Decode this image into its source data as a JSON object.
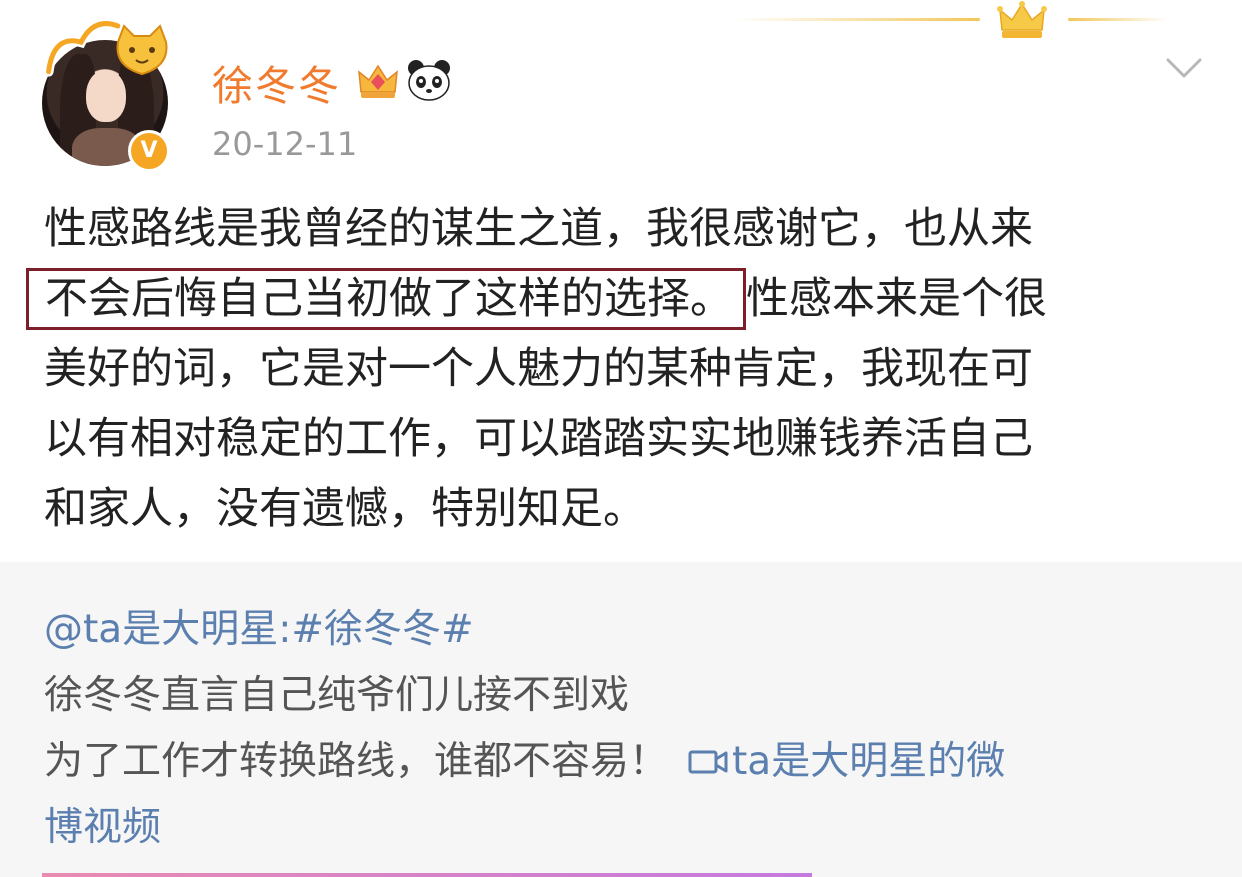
{
  "user": {
    "name": "徐冬冬",
    "date": "20-12-11",
    "avatar_sticker": "",
    "verified_badge": "V"
  },
  "post": {
    "line1": "性感路线是我曾经的谋生之道，我很感谢它，也从来",
    "line2_highlight": "不会后悔自己当初做了这样的选择。",
    "line2_rest": "性感本来是个很",
    "line3": "美好的词，它是对一个人魅力的某种肯定，我现在可",
    "line4": "以有相对稳定的工作，可以踏踏实实地赚钱养活自己",
    "line5": "和家人，没有遗憾，特别知足。"
  },
  "repost": {
    "user": "@ta是大明星",
    "separator": ":",
    "hashtag": "#徐冬冬#",
    "line1": "徐冬冬直言自己纯爷们儿接不到戏",
    "line2": "为了工作才转换路线，谁都不容易！",
    "video_link_part1": "ta是大明星的微",
    "video_link_part2": "博视频"
  },
  "icons": {
    "crown": "crown-icon",
    "vip": "vip-crown-icon",
    "panda": "panda-icon",
    "more": "chevron-down-icon",
    "video": "video-camera-icon"
  },
  "colors": {
    "name": "#f07b2f",
    "link": "#5b7fae",
    "highlight_border": "#7d1f2b",
    "repost_bg": "#f6f6f6"
  }
}
